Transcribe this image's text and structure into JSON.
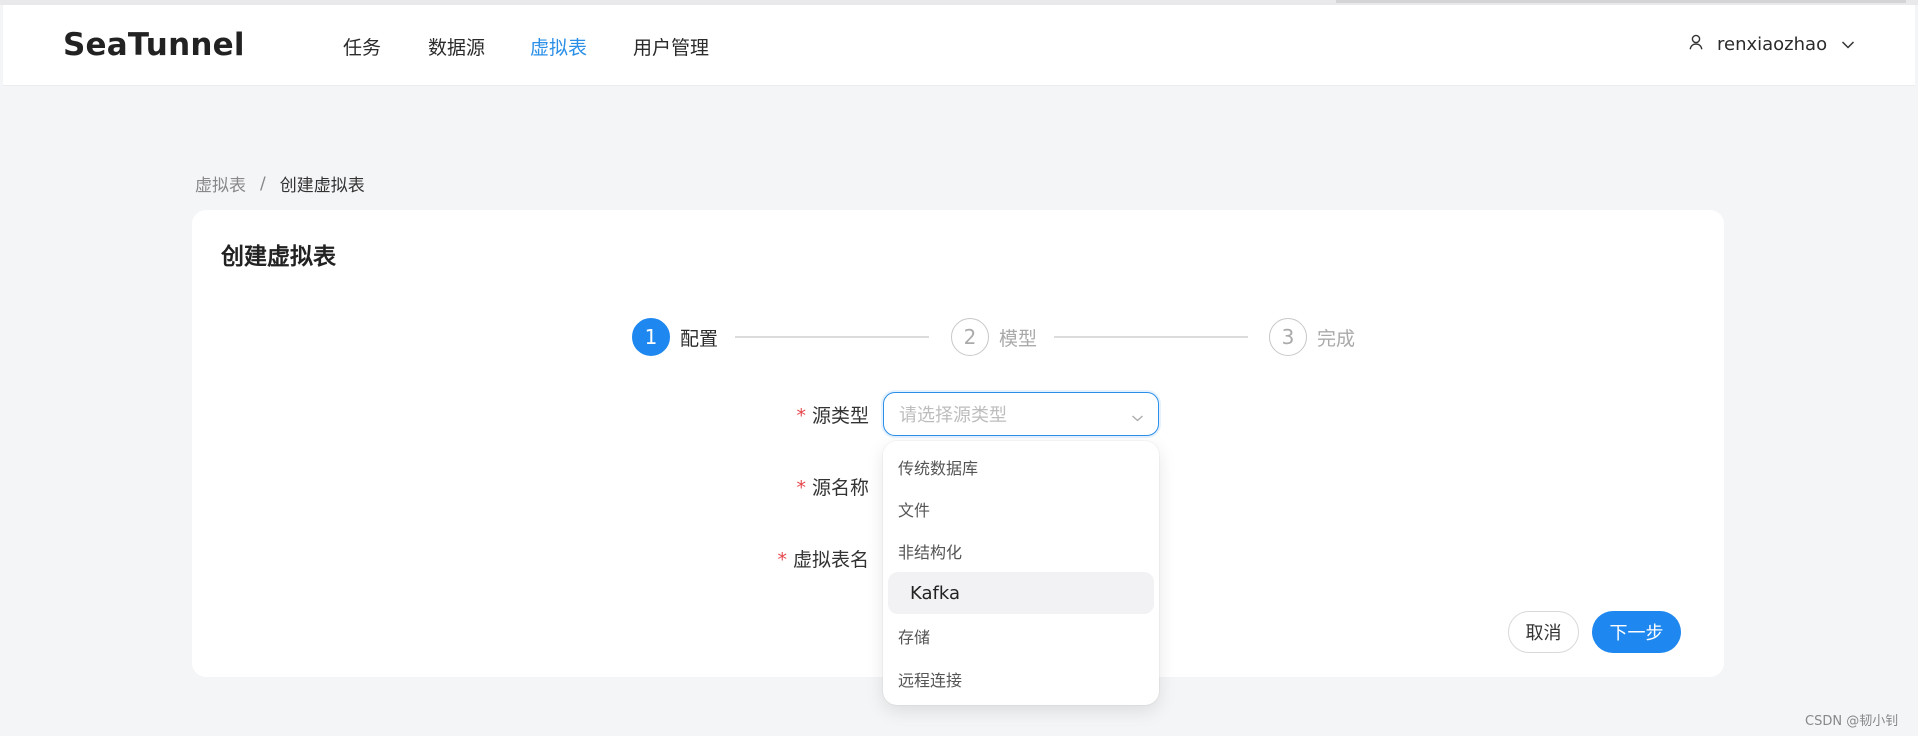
{
  "app": {
    "brand": "SeaTunnel"
  },
  "nav": {
    "items": [
      {
        "label": "任务"
      },
      {
        "label": "数据源"
      },
      {
        "label": "虚拟表"
      },
      {
        "label": "用户管理"
      }
    ],
    "active": "虚拟表"
  },
  "user": {
    "name": "renxiaozhao",
    "icon": "user-icon"
  },
  "breadcrumb": {
    "parent": "虚拟表",
    "separator": "/",
    "current": "创建虚拟表"
  },
  "card": {
    "title": "创建虚拟表"
  },
  "steps": [
    {
      "num": "1",
      "label": "配置",
      "active": true
    },
    {
      "num": "2",
      "label": "模型",
      "active": false
    },
    {
      "num": "3",
      "label": "完成",
      "active": false
    }
  ],
  "form": {
    "required_mark": "*",
    "source_type_label": "源类型",
    "source_name_label": "源名称",
    "table_name_label": "虚拟表名",
    "source_type_placeholder": "请选择源类型"
  },
  "dropdown": {
    "options": [
      "传统数据库",
      "文件",
      "非结构化",
      "Kafka",
      "存储",
      "远程连接"
    ],
    "hovered": "Kafka"
  },
  "buttons": {
    "cancel": "取消",
    "next": "下一步"
  },
  "watermark": "CSDN @韧小钊",
  "colors": {
    "accent": "#1e88f0",
    "nav_active": "#2b8fe8",
    "required": "#e5484d"
  }
}
